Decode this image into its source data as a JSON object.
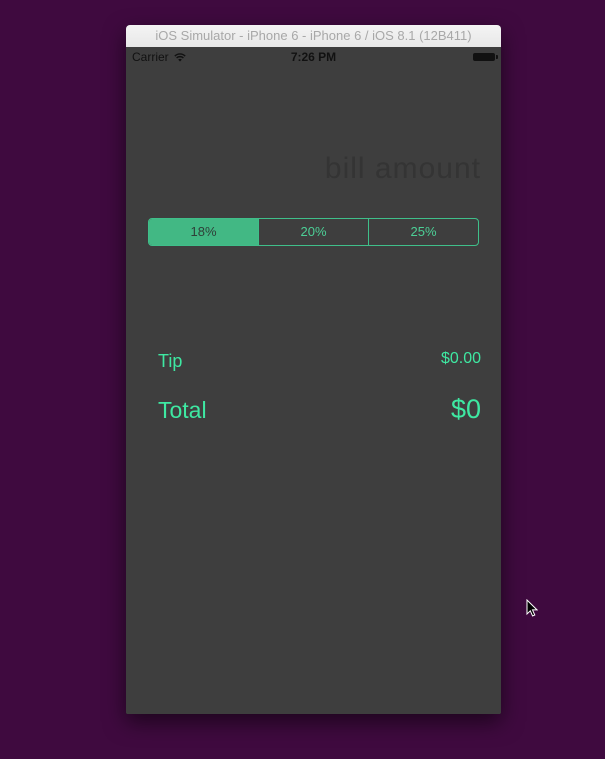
{
  "window": {
    "title": "iOS Simulator - iPhone 6 - iPhone 6 / iOS 8.1 (12B411)"
  },
  "statusbar": {
    "carrier": "Carrier",
    "time": "7:26 PM",
    "wifi_icon": "wifi-icon",
    "battery_icon": "battery-icon"
  },
  "bill": {
    "value": "",
    "placeholder": "bill amount"
  },
  "tip_selector": {
    "options": [
      "18%",
      "20%",
      "25%"
    ],
    "selected": "18%"
  },
  "results": {
    "tip_label": "Tip",
    "tip_value": "$0.00",
    "total_label": "Total",
    "total_value": "$0"
  },
  "colors": {
    "accent": "#3ee8a2",
    "segment_selected": "#42b884",
    "screen_background": "#3e3e3e",
    "desktop_background": "#3f0a3f"
  },
  "cursor_icon": "arrow-cursor-icon"
}
